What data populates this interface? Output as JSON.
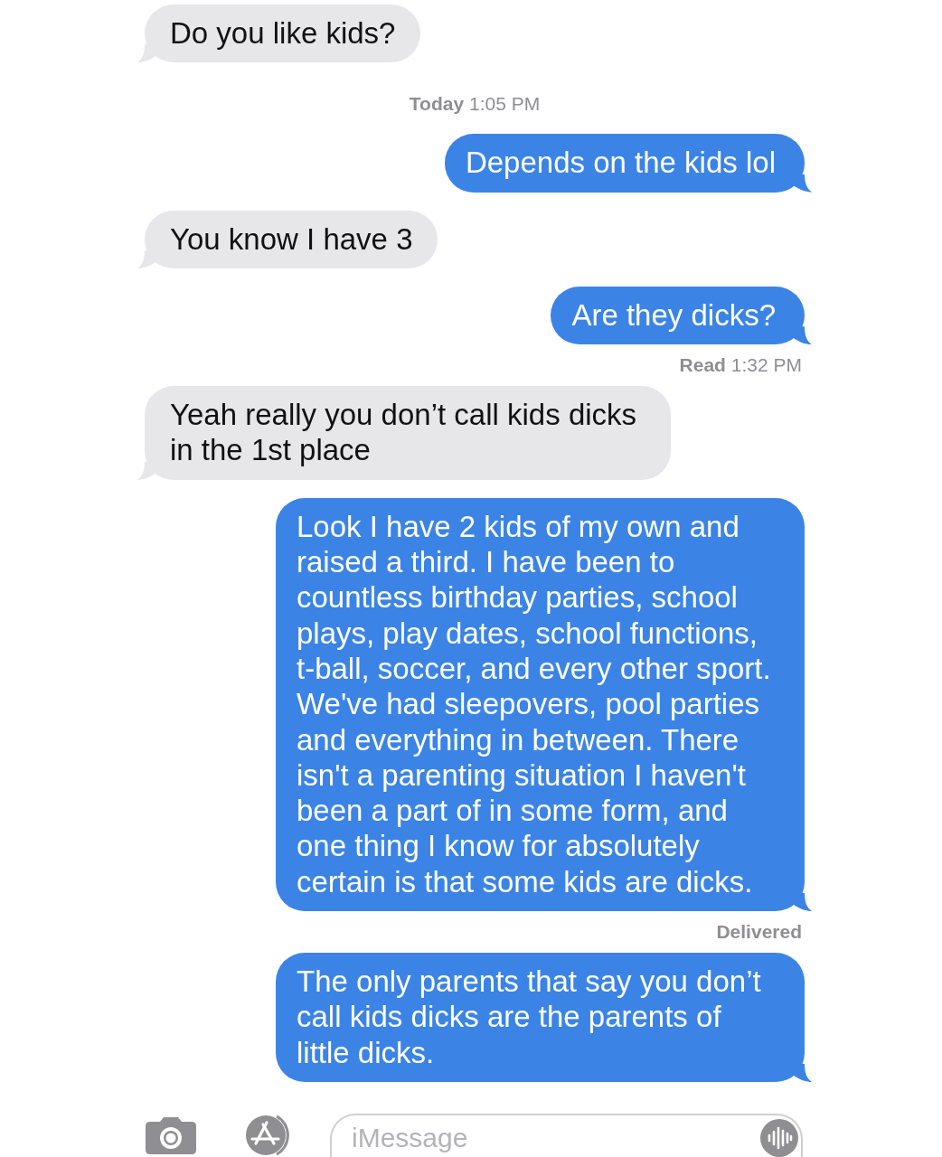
{
  "messages": [
    {
      "kind": "incoming",
      "text": "Do you like kids?"
    },
    {
      "kind": "timestamp",
      "day": "Today",
      "time": "1:05 PM"
    },
    {
      "kind": "outgoing",
      "text": "Depends on the kids lol"
    },
    {
      "kind": "incoming",
      "text": "You know I have 3"
    },
    {
      "kind": "outgoing",
      "text": "Are they dicks?"
    },
    {
      "kind": "receipt",
      "status": "Read",
      "time": "1:32 PM"
    },
    {
      "kind": "incoming",
      "text": "Yeah really you don’t call kids dicks in the 1st place"
    },
    {
      "kind": "outgoing",
      "text": "Look I have 2 kids of my own and raised a third. I have been to countless birthday parties, school plays, play dates, school functions, t-ball, soccer, and every other sport. We've had sleepovers, pool parties and everything in between. There isn't a parenting situation I haven't been a part of in some form, and one thing I know for absolutely certain is that some kids are dicks."
    },
    {
      "kind": "receipt",
      "status": "Delivered"
    },
    {
      "kind": "outgoing",
      "text": "The only parents that say you don’t call kids dicks are the parents of little dicks."
    }
  ],
  "composer": {
    "placeholder": "iMessage"
  }
}
